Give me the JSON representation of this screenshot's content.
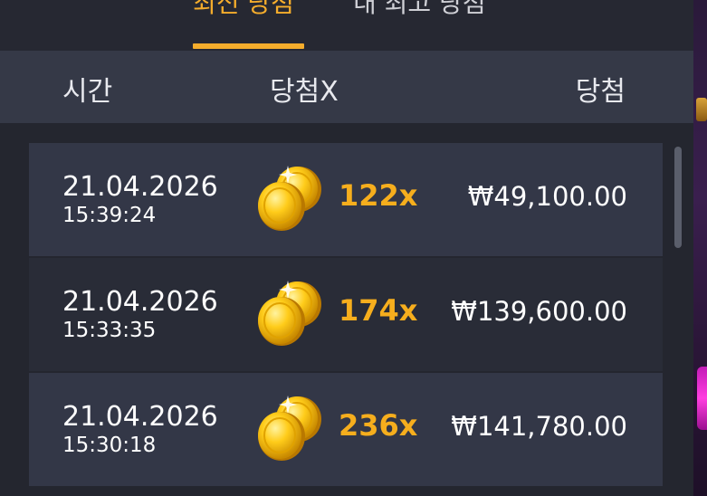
{
  "tabs": [
    {
      "label": "최신 당첨",
      "active": true
    },
    {
      "label": "내 최고 당첨",
      "active": false
    }
  ],
  "columns": {
    "time": "시간",
    "multiplier": "당첨X",
    "win": "당첨"
  },
  "rows": [
    {
      "date": "21.04.2026",
      "time": "15:39:24",
      "icon": "gold-coins-icon",
      "multiplier": "122x",
      "amount": "₩49,100.00"
    },
    {
      "date": "21.04.2026",
      "time": "15:33:35",
      "icon": "gold-coins-icon",
      "multiplier": "174x",
      "amount": "₩139,600.00"
    },
    {
      "date": "21.04.2026",
      "time": "15:30:18",
      "icon": "gold-coins-icon",
      "multiplier": "236x",
      "amount": "₩141,780.00"
    }
  ],
  "colors": {
    "accent": "#f5ad2c",
    "header_bg": "#353947",
    "row_bg": "#333747",
    "row_alt_bg": "#292c37",
    "page_bg": "#24262f"
  }
}
